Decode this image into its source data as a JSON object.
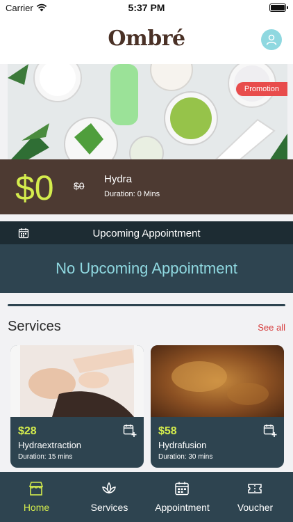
{
  "status_bar": {
    "carrier": "Carrier",
    "time": "5:37 PM"
  },
  "header": {
    "logo": "Ombré"
  },
  "promotion": {
    "badge": "Promotion",
    "price": "$0",
    "original_price": "$0",
    "name": "Hydra",
    "duration": "Duration: 0 Mins"
  },
  "appointment": {
    "title": "Upcoming Appointment",
    "empty_message": "No Upcoming Appointment"
  },
  "services": {
    "title": "Services",
    "see_all": "See all",
    "items": [
      {
        "price": "$28",
        "name": "Hydraextraction",
        "duration": "Duration: 15 mins"
      },
      {
        "price": "$58",
        "name": "Hydrafusion",
        "duration": "Duration: 30 mins"
      }
    ]
  },
  "tabs": [
    {
      "label": "Home",
      "icon": "store-icon",
      "active": true
    },
    {
      "label": "Services",
      "icon": "lotus-icon",
      "active": false
    },
    {
      "label": "Appointment",
      "icon": "calendar-icon",
      "active": false
    },
    {
      "label": "Voucher",
      "icon": "ticket-icon",
      "active": false
    }
  ],
  "colors": {
    "accent": "#d4ec4d",
    "primary_dark": "#2e4450",
    "brown": "#4d3a32",
    "badge_red": "#e84c4c",
    "link_red": "#d63b3b",
    "teal": "#8fd8e0"
  }
}
